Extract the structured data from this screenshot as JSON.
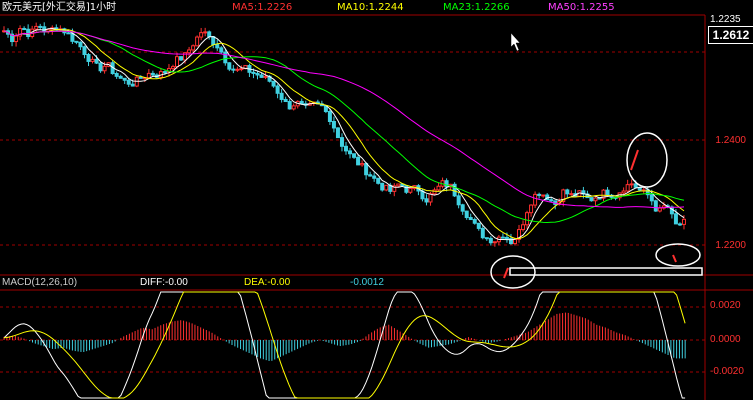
{
  "header": {
    "title": "欧元美元[外汇交易]1小时",
    "ma5": "MA5:1.2226",
    "ma10": "MA10:1.2244",
    "ma23": "MA23:1.2266",
    "ma50": "MA50:1.2255"
  },
  "price_axis": {
    "top_tick": "1.2235",
    "current": "1.2612",
    "ticks": [
      "1.2400",
      "1.2200"
    ]
  },
  "macd_header": {
    "name": "MACD(12,26,10)",
    "diff": "DIFF:-0.00",
    "dea": "DEA:-0.00",
    "macd": "-0.0012"
  },
  "macd_axis": {
    "ticks": [
      "0.0020",
      "0.0000",
      "-0.0020"
    ]
  },
  "colors": {
    "bull": "#ff3030",
    "bear": "#40d0e0",
    "ma5": "#ffffff",
    "ma10": "#ffff00",
    "ma23": "#00ff00",
    "ma50": "#ff00ff",
    "grid": "#a00000"
  },
  "chart_data": {
    "type": "candlestick",
    "title": "欧元美元[外汇交易]1小时",
    "price_ylim": [
      1.211,
      1.271
    ],
    "macd_ylim": [
      -0.003,
      0.003
    ],
    "series": [
      {
        "name": "MA5",
        "value": 1.2226
      },
      {
        "name": "MA10",
        "value": 1.2244
      },
      {
        "name": "MA23",
        "value": 1.2266
      },
      {
        "name": "MA50",
        "value": 1.2255
      }
    ],
    "close_path": [
      1.268,
      1.266,
      1.269,
      1.267,
      1.2695,
      1.2675,
      1.269,
      1.268,
      1.266,
      1.264,
      1.261,
      1.259,
      1.26,
      1.2575,
      1.256,
      1.2555,
      1.257,
      1.258,
      1.2575,
      1.259,
      1.261,
      1.262,
      1.265,
      1.268,
      1.266,
      1.264,
      1.26,
      1.2585,
      1.259,
      1.258,
      1.257,
      1.256,
      1.253,
      1.25,
      1.251,
      1.2495,
      1.2505,
      1.25,
      1.247,
      1.242,
      1.239,
      1.237,
      1.235,
      1.233,
      1.231,
      1.23,
      1.232,
      1.23,
      1.231,
      1.228,
      1.23,
      1.232,
      1.231,
      1.227,
      1.224,
      1.221,
      1.219,
      1.2185,
      1.22,
      1.218,
      1.221,
      1.227,
      1.23,
      1.229,
      1.227,
      1.23,
      1.229,
      1.2295,
      1.228,
      1.229,
      1.23,
      1.229,
      1.231,
      1.232,
      1.23,
      1.229,
      1.225,
      1.227,
      1.222,
      1.2226
    ],
    "macd_hist": [
      0.0002,
      0.0003,
      0.0001,
      -0.0002,
      -0.0004,
      -0.0006,
      -0.0005,
      -0.0007,
      -0.0008,
      -0.0006,
      -0.0004,
      -0.0002,
      0.0002,
      0.0005,
      0.0008,
      0.0007,
      0.001,
      0.0012,
      0.0013,
      0.0011,
      0.0008,
      0.0005,
      0.0001,
      -0.0003,
      -0.0006,
      -0.0009,
      -0.0012,
      -0.0014,
      -0.0011,
      -0.0008,
      -0.0005,
      -0.0002,
      0.0,
      -0.0002,
      -0.0004,
      -0.0003,
      -0.0001,
      0.0004,
      0.0008,
      0.001,
      0.0006,
      0.0002,
      -0.0002,
      -0.0005,
      -0.0004,
      -0.0003,
      -0.0001,
      0.0002,
      0.0,
      -0.0002,
      -0.0001,
      0.0001,
      0.0003,
      0.0005,
      0.0009,
      0.0013,
      0.0017,
      0.0018,
      0.0016,
      0.0014,
      0.001,
      0.0008,
      0.0005,
      0.0003,
      0.0,
      -0.0003,
      -0.0006,
      -0.0009,
      -0.0012,
      -0.0012
    ]
  }
}
